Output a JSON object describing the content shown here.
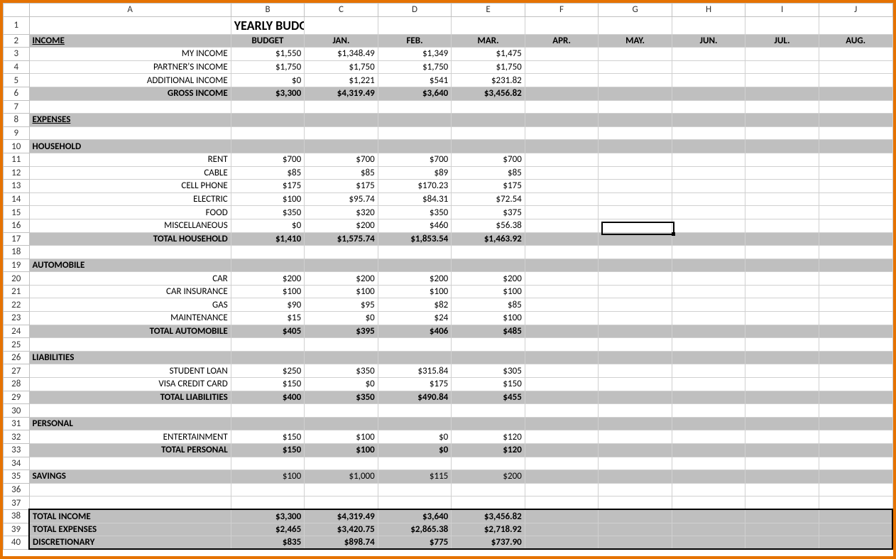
{
  "columns": [
    "A",
    "B",
    "C",
    "D",
    "E",
    "F",
    "G",
    "H",
    "I",
    "J"
  ],
  "title": "YEARLY BUDGET",
  "headers": {
    "A": "INCOME",
    "B": "BUDGET",
    "C": "JAN.",
    "D": "FEB.",
    "E": "MAR.",
    "F": "APR.",
    "G": "MAY.",
    "H": "JUN.",
    "I": "JUL.",
    "J": "AUG."
  },
  "income": {
    "rows": [
      {
        "label": "MY INCOME",
        "vals": [
          "$1,550",
          "$1,348.49",
          "$1,349",
          "$1,475"
        ]
      },
      {
        "label": "PARTNER'S INCOME",
        "vals": [
          "$1,750",
          "$1,750",
          "$1,750",
          "$1,750"
        ]
      },
      {
        "label": "ADDITIONAL INCOME",
        "vals": [
          "$0",
          "$1,221",
          "$541",
          "$231.82"
        ]
      }
    ],
    "total": {
      "label": "GROSS INCOME",
      "vals": [
        "$3,300",
        "$4,319.49",
        "$3,640",
        "$3,456.82"
      ]
    }
  },
  "expenses_label": "EXPENSES",
  "household": {
    "label": "HOUSEHOLD",
    "rows": [
      {
        "label": "RENT",
        "vals": [
          "$700",
          "$700",
          "$700",
          "$700"
        ]
      },
      {
        "label": "CABLE",
        "vals": [
          "$85",
          "$85",
          "$89",
          "$85"
        ]
      },
      {
        "label": "CELL PHONE",
        "vals": [
          "$175",
          "$175",
          "$170.23",
          "$175"
        ]
      },
      {
        "label": "ELECTRIC",
        "vals": [
          "$100",
          "$95.74",
          "$84.31",
          "$72.54"
        ]
      },
      {
        "label": "FOOD",
        "vals": [
          "$350",
          "$320",
          "$350",
          "$375"
        ]
      },
      {
        "label": "MISCELLANEOUS",
        "vals": [
          "$0",
          "$200",
          "$460",
          "$56.38"
        ]
      }
    ],
    "total": {
      "label": "TOTAL HOUSEHOLD",
      "vals": [
        "$1,410",
        "$1,575.74",
        "$1,853.54",
        "$1,463.92"
      ]
    }
  },
  "automobile": {
    "label": "AUTOMOBILE",
    "rows": [
      {
        "label": "CAR",
        "vals": [
          "$200",
          "$200",
          "$200",
          "$200"
        ]
      },
      {
        "label": "CAR INSURANCE",
        "vals": [
          "$100",
          "$100",
          "$100",
          "$100"
        ]
      },
      {
        "label": "GAS",
        "vals": [
          "$90",
          "$95",
          "$82",
          "$85"
        ]
      },
      {
        "label": "MAINTENANCE",
        "vals": [
          "$15",
          "$0",
          "$24",
          "$100"
        ]
      }
    ],
    "total": {
      "label": "TOTAL AUTOMOBILE",
      "vals": [
        "$405",
        "$395",
        "$406",
        "$485"
      ]
    }
  },
  "liabilities": {
    "label": "LIABILITIES",
    "rows": [
      {
        "label": "STUDENT LOAN",
        "vals": [
          "$250",
          "$350",
          "$315.84",
          "$305"
        ]
      },
      {
        "label": "VISA CREDIT CARD",
        "vals": [
          "$150",
          "$0",
          "$175",
          "$150"
        ]
      }
    ],
    "total": {
      "label": "TOTAL LIABILITIES",
      "vals": [
        "$400",
        "$350",
        "$490.84",
        "$455"
      ]
    }
  },
  "personal": {
    "label": "PERSONAL",
    "rows": [
      {
        "label": "ENTERTAINMENT",
        "vals": [
          "$150",
          "$100",
          "$0",
          "$120"
        ]
      }
    ],
    "total": {
      "label": "TOTAL PERSONAL",
      "vals": [
        "$150",
        "$100",
        "$0",
        "$120"
      ]
    }
  },
  "savings": {
    "label": "SAVINGS",
    "vals": [
      "$100",
      "$1,000",
      "$115",
      "$200"
    ]
  },
  "summary": [
    {
      "label": "TOTAL INCOME",
      "vals": [
        "$3,300",
        "$4,319.49",
        "$3,640",
        "$3,456.82"
      ]
    },
    {
      "label": "TOTAL EXPENSES",
      "vals": [
        "$2,465",
        "$3,420.75",
        "$2,865.38",
        "$2,718.92"
      ]
    },
    {
      "label": "DISCRETIONARY",
      "vals": [
        "$835",
        "$898.74",
        "$775",
        "$737.90"
      ]
    }
  ],
  "selection": {
    "cell": "G16"
  }
}
